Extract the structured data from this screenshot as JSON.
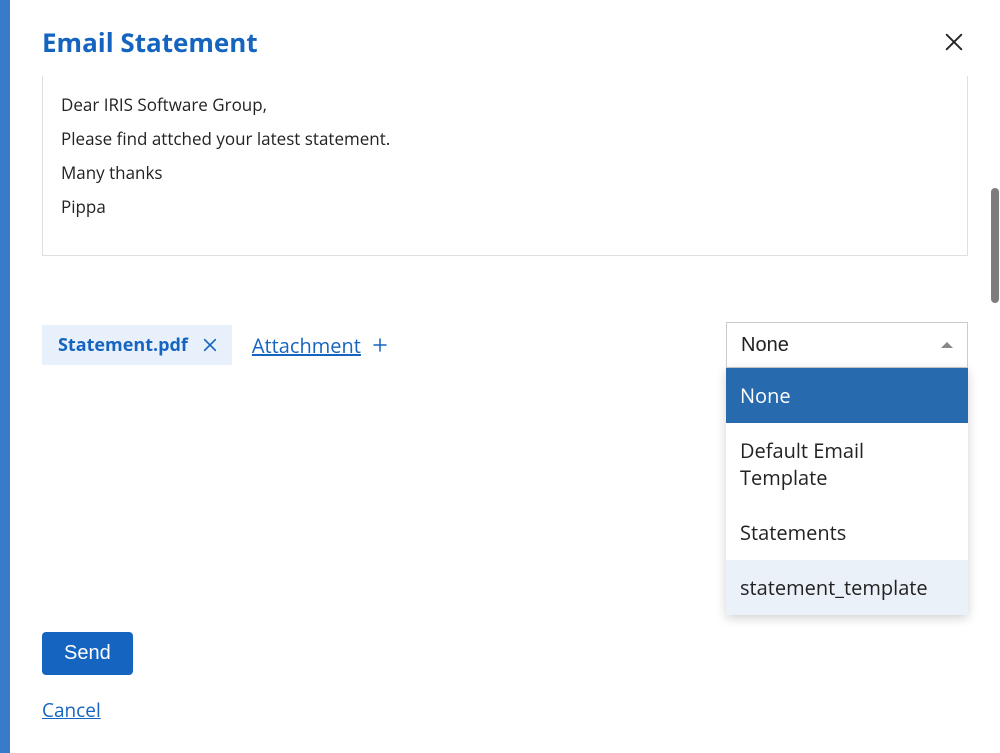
{
  "header": {
    "title": "Email Statement"
  },
  "message": {
    "lines": [
      "Dear IRIS Software Group,",
      "Please find attched your latest statement.",
      "Many thanks",
      "Pippa"
    ]
  },
  "attachment": {
    "chip_label": "Statement.pdf",
    "link_label": "Attachment"
  },
  "template_select": {
    "value": "None",
    "options": [
      {
        "label": "None",
        "selected": true,
        "hover": false
      },
      {
        "label": "Default Email Template",
        "selected": false,
        "hover": false
      },
      {
        "label": "Statements",
        "selected": false,
        "hover": false
      },
      {
        "label": "statement_template",
        "selected": false,
        "hover": true
      }
    ]
  },
  "actions": {
    "send": "Send",
    "cancel": "Cancel"
  }
}
